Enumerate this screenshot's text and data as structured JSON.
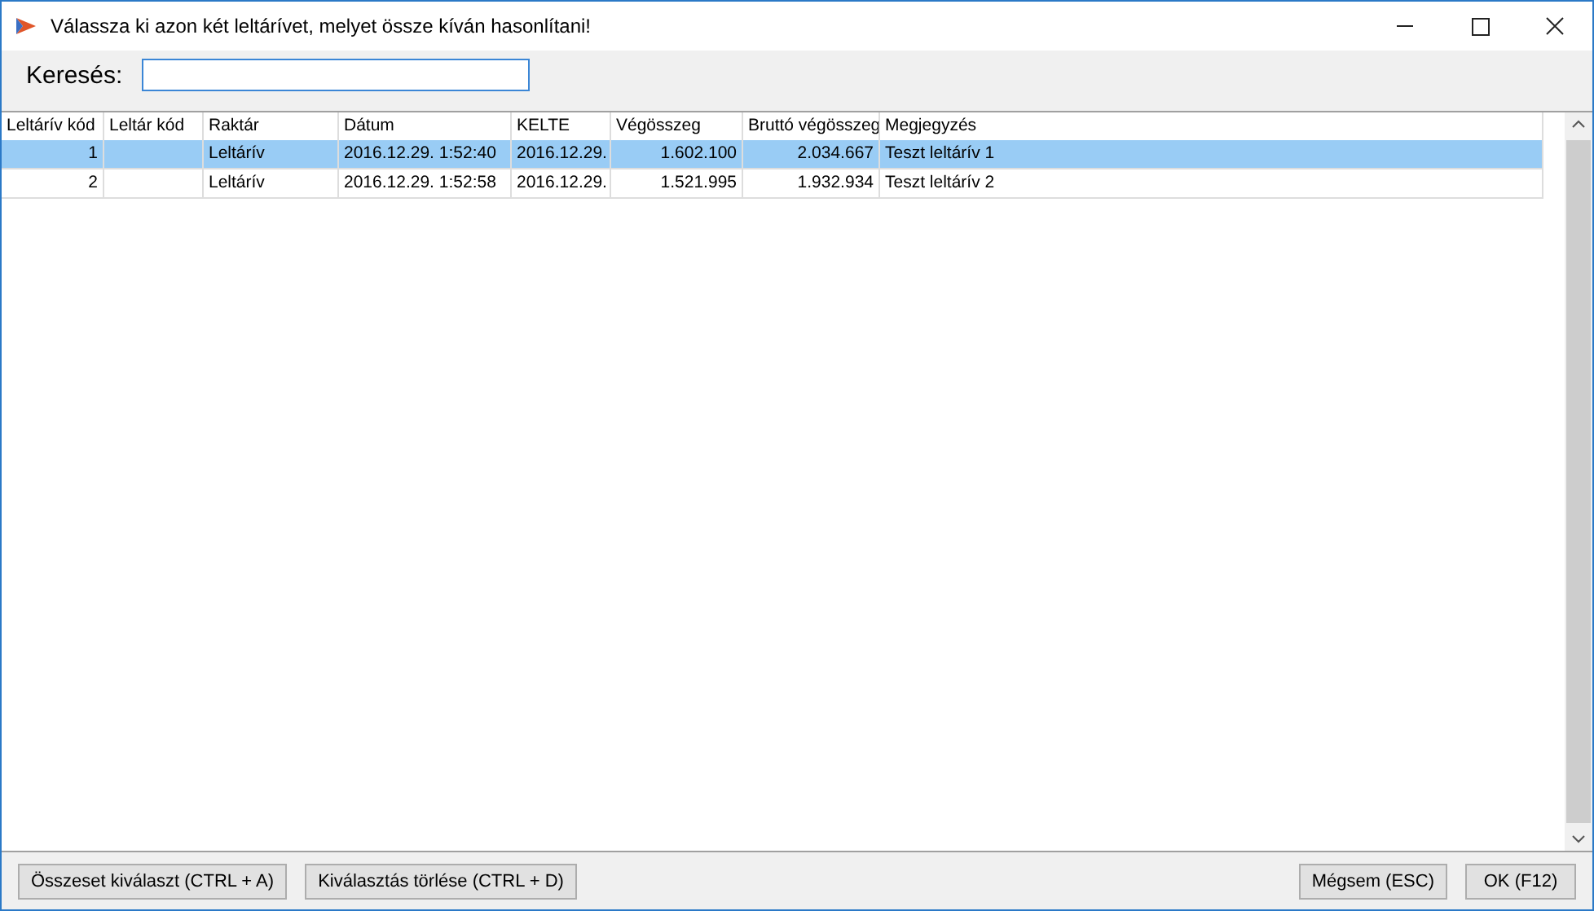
{
  "window": {
    "title": "Válassza ki azon két leltárívet, melyet össze kíván hasonlítani!"
  },
  "search": {
    "label": "Keresés:"
  },
  "table": {
    "columns": [
      "Leltárív kód",
      "Leltár kód",
      "Raktár",
      "Dátum",
      "KELTE",
      "Végösszeg",
      "Bruttó végösszeg",
      "Megjegyzés"
    ],
    "rows": [
      {
        "selected": true,
        "cells": [
          "1",
          "",
          "Leltárív",
          "2016.12.29. 1:52:40",
          "2016.12.29.",
          "1.602.100",
          "2.034.667",
          "Teszt leltárív 1"
        ]
      },
      {
        "selected": false,
        "cells": [
          "2",
          "",
          "Leltárív",
          "2016.12.29. 1:52:58",
          "2016.12.29.",
          "1.521.995",
          "1.932.934",
          "Teszt leltárív 2"
        ]
      }
    ]
  },
  "buttons_left": [
    "Összeset kiválaszt (CTRL + A)",
    "Kiválasztás törlése (CTRL + D)"
  ],
  "buttons_right": [
    "Mégsem (ESC)",
    "OK (F12)"
  ]
}
